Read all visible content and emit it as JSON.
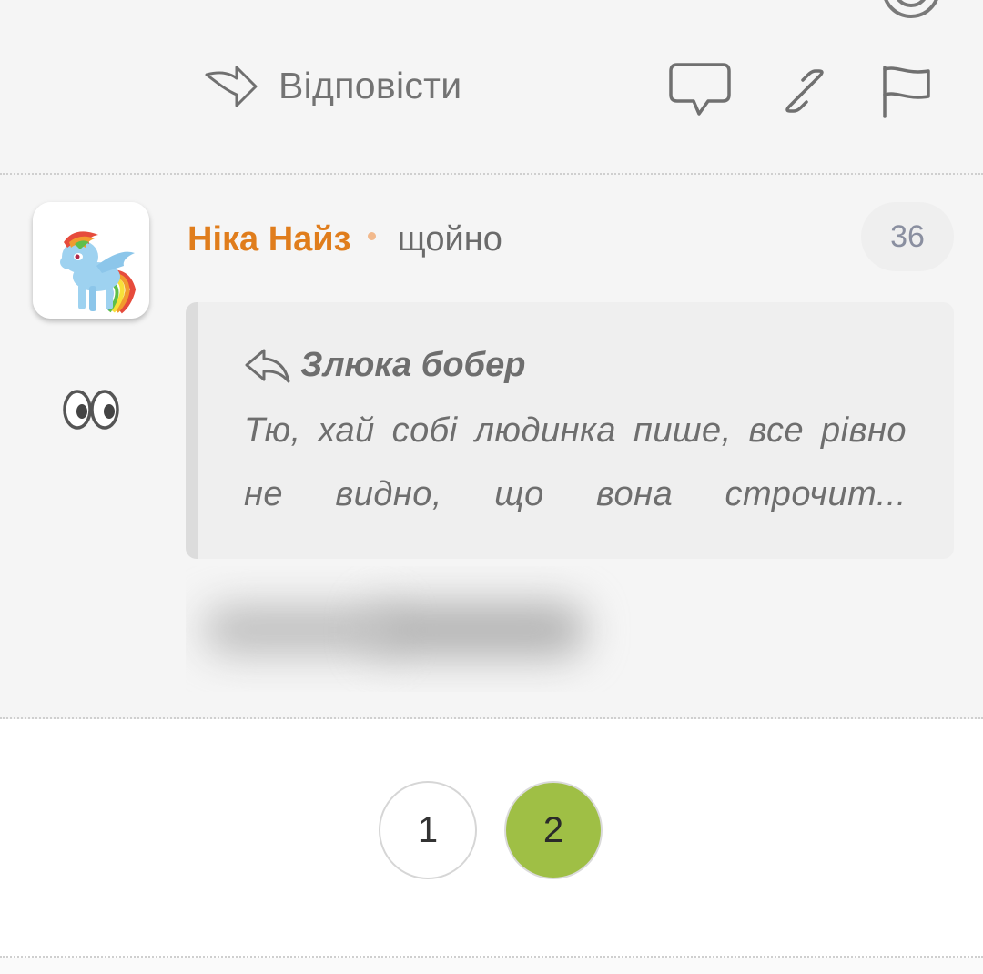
{
  "actions": {
    "reply_label": "Відповісти"
  },
  "comment": {
    "author": "Ніка Найз",
    "time": "щойно",
    "rating": "36",
    "quote": {
      "author": "Злюка бобер",
      "text": "Тю, хай собі людинка пише, все рівно не видно, що вона строчит..."
    }
  },
  "pagination": {
    "pages": [
      "1",
      "2"
    ],
    "active_page": "2"
  },
  "colors": {
    "author": "#e07d1c",
    "active_page": "#9fbf45",
    "background": "#f5f5f5"
  },
  "icons": {
    "reply": "reply-arrow-icon",
    "comment": "speech-bubble-icon",
    "link": "link-icon",
    "flag": "flag-icon",
    "eyes": "eyes-icon",
    "quote_reply": "reply-back-arrow-icon"
  }
}
